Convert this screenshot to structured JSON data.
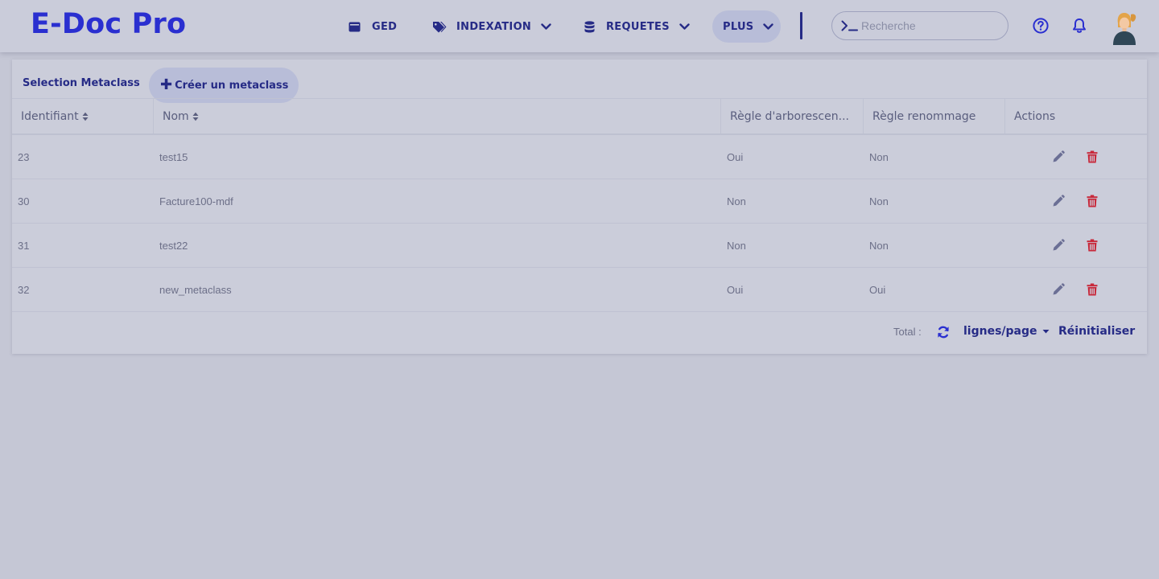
{
  "app": {
    "logo": "E-Doc Pro"
  },
  "nav": {
    "ged": "GED",
    "indexation": "INDEXATION",
    "requetes": "REQUETES",
    "plus": "PLUS"
  },
  "search": {
    "placeholder": "Recherche",
    "value": ""
  },
  "icons": {
    "ged": "folder-icon",
    "indexation": "tags-icon",
    "requetes": "database-icon",
    "search": "terminal-icon",
    "help": "help-icon",
    "notifications": "bell-icon",
    "edit": "pencil-icon",
    "delete": "trash-icon",
    "refresh": "refresh-icon"
  },
  "colors": {
    "brand": "#2a2fd0",
    "nav_text": "#262b86",
    "delete": "#c8283a",
    "edit": "#6b6f95"
  },
  "panel": {
    "title": "Selection Metaclass",
    "create_button": "Créer un metaclass"
  },
  "table": {
    "columns": [
      "Identifiant",
      "Nom",
      "Règle d'arborescen...",
      "Règle renommage",
      "Actions"
    ],
    "rows": [
      {
        "id": "23",
        "nom": "test15",
        "arbo": "Oui",
        "renommage": "Non"
      },
      {
        "id": "30",
        "nom": "Facture100-mdf",
        "arbo": "Non",
        "renommage": "Non"
      },
      {
        "id": "31",
        "nom": "test22",
        "arbo": "Non",
        "renommage": "Non"
      },
      {
        "id": "32",
        "nom": "new_metaclass",
        "arbo": "Oui",
        "renommage": "Oui"
      }
    ]
  },
  "footer": {
    "total_label": "Total :",
    "lines_per_page": "lignes/page",
    "reset": "Réinitialiser"
  }
}
